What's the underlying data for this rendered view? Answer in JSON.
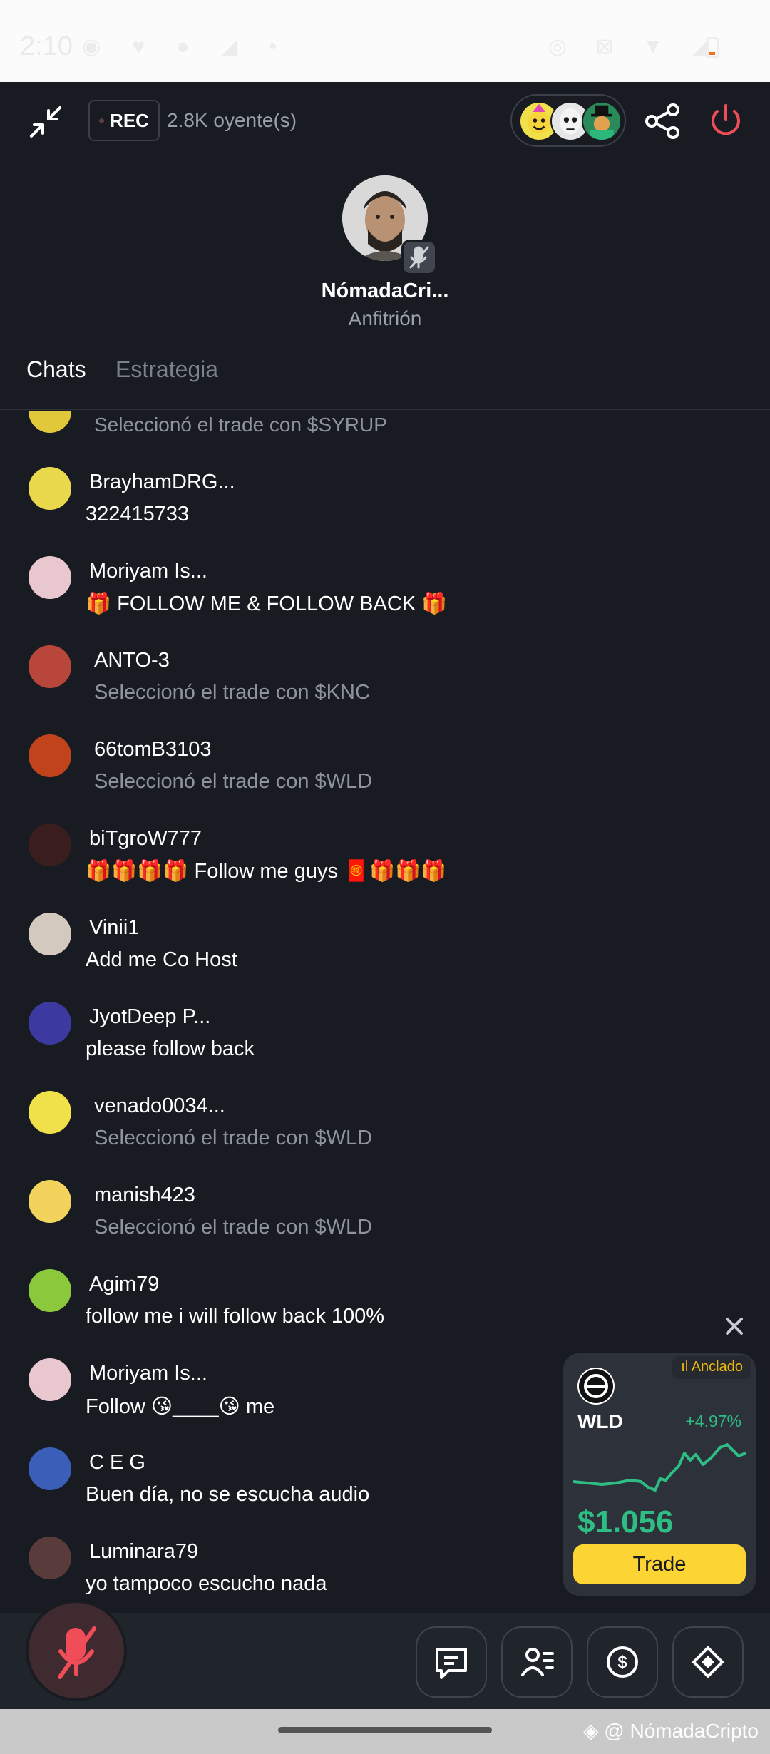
{
  "status_bar": {
    "time": "2:10",
    "icons_left": "◉ ♥ ● ◢ •",
    "icons_right": "◎ ⊠ ▼ ◢"
  },
  "header": {
    "rec_label": "REC",
    "listeners": "2.8K oyente(s)"
  },
  "host": {
    "name": "NómadaCri...",
    "role": "Anfitrión"
  },
  "tabs": [
    {
      "label": "Chats",
      "active": true
    },
    {
      "label": "Estrategia",
      "active": false
    }
  ],
  "chat": {
    "partial_text": "Seleccionó el trade con $SYRUP",
    "messages": [
      {
        "type": "user",
        "name": "BrayhamDRG...",
        "text": "322415733",
        "avatar_color": "#e9d74c"
      },
      {
        "type": "user",
        "name": "Moriyam Is...",
        "text": "🎁 FOLLOW ME  &  FOLLOW BACK 🎁",
        "avatar_color": "#e8c7cf"
      },
      {
        "type": "sys",
        "name": "ANTO-3",
        "text": "Seleccionó el trade con $KNC",
        "avatar_color": "#b8463a"
      },
      {
        "type": "sys",
        "name": "66tomB3103",
        "text": "Seleccionó el trade con $WLD",
        "avatar_color": "#c0431c"
      },
      {
        "type": "user",
        "name": "biTgroW777",
        "text": "🎁🎁🎁🎁 Follow me guys 🧧🎁🎁🎁",
        "avatar_color": "#3a1e1e"
      },
      {
        "type": "user",
        "name": "Vinii1",
        "text": "Add me Co Host",
        "avatar_color": "#d4c9bf"
      },
      {
        "type": "user",
        "name": "JyotDeep P...",
        "text": "please follow back",
        "avatar_color": "#3c3aa1"
      },
      {
        "type": "sys",
        "name": "venado0034...",
        "text": "Seleccionó el trade con $WLD",
        "avatar_color": "#f0e04a"
      },
      {
        "type": "sys",
        "name": "manish423",
        "text": "Seleccionó el trade con $WLD",
        "avatar_color": "#f2d45c"
      },
      {
        "type": "user",
        "name": "Agim79",
        "text": "follow me i will follow back 100%",
        "avatar_color": "#8cc83b"
      },
      {
        "type": "user",
        "name": "Moriyam Is...",
        "text": "Follow 😘____😘 me",
        "avatar_color": "#e8c7cf"
      },
      {
        "type": "user",
        "name": "C E G",
        "text": "Buen día, no se escucha audio",
        "avatar_color": "#3b5fb8"
      },
      {
        "type": "user",
        "name": "Luminara79",
        "text": "yo tampoco escucho nada",
        "avatar_color": "#5a3b3b"
      }
    ]
  },
  "trade_widget": {
    "pinned_label": "Anclado",
    "symbol": "WLD",
    "change": "+4.97%",
    "price": "$1.056",
    "button_label": "Trade",
    "accent": "#2ebd85",
    "button_color": "#fcd535"
  },
  "bottom_actions": [
    "chat-icon",
    "speakers-list-icon",
    "dollar-icon",
    "binance-icon"
  ],
  "watermark": "@ NómadaCripto",
  "colors": {
    "background": "#181b21",
    "secondary_text": "#8f949c",
    "danger": "#f04d58"
  }
}
